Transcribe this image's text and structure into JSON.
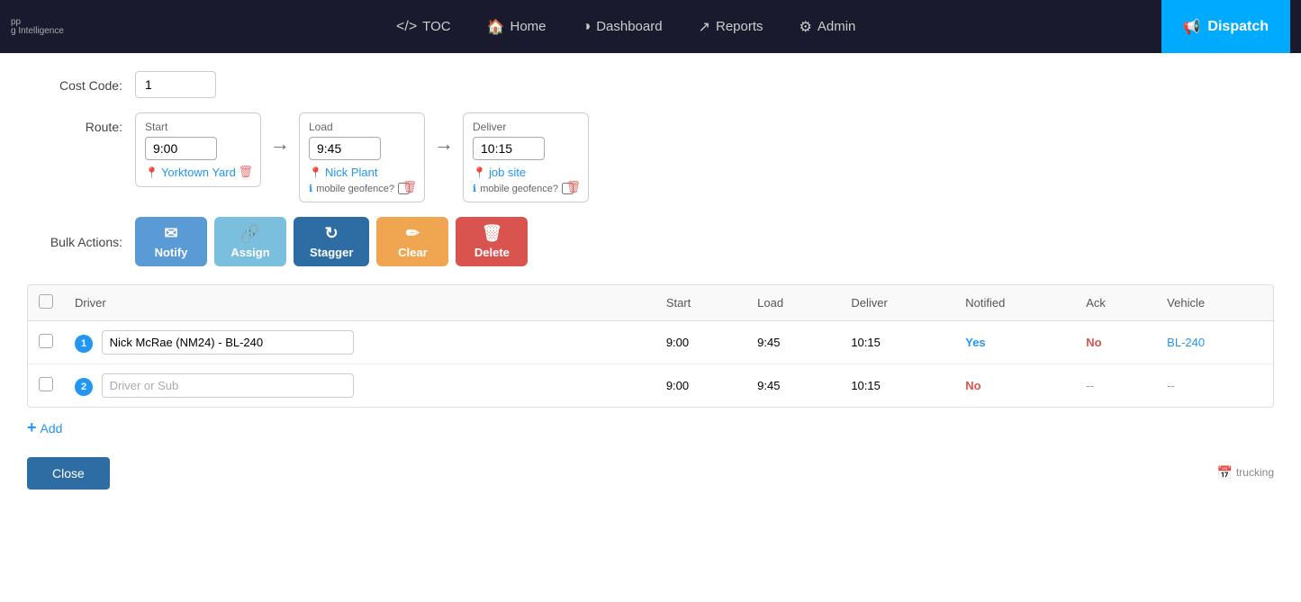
{
  "navbar": {
    "brand": "pp",
    "brand_sub": "g Intelligence",
    "links": [
      {
        "id": "toc",
        "icon": "</>",
        "label": "TOC"
      },
      {
        "id": "home",
        "icon": "🏠",
        "label": "Home"
      },
      {
        "id": "dashboard",
        "icon": "◑",
        "label": "Dashboard"
      },
      {
        "id": "reports",
        "icon": "↗",
        "label": "Reports"
      },
      {
        "id": "admin",
        "icon": "⚙",
        "label": "Admin"
      }
    ],
    "dispatch_label": "Dispatch"
  },
  "cost_code": {
    "label": "Cost Code:",
    "value": "1"
  },
  "route": {
    "label": "Route:",
    "start": {
      "section_label": "Start",
      "time": "9:00",
      "location": "Yorktown Yard"
    },
    "load": {
      "section_label": "Load",
      "time": "9:45",
      "location": "Nick Plant",
      "geofence": "mobile geofence?"
    },
    "deliver": {
      "section_label": "Deliver",
      "time": "10:15",
      "location": "job site",
      "geofence": "mobile geofence?"
    }
  },
  "bulk_actions": {
    "label": "Bulk Actions:",
    "buttons": [
      {
        "id": "notify",
        "icon": "✉",
        "label": "Notify",
        "cls": "btn-notify"
      },
      {
        "id": "assign",
        "icon": "🔗",
        "label": "Assign",
        "cls": "btn-assign"
      },
      {
        "id": "stagger",
        "icon": "↻",
        "label": "Stagger",
        "cls": "btn-stagger"
      },
      {
        "id": "clear",
        "icon": "✏",
        "label": "Clear",
        "cls": "btn-clear"
      },
      {
        "id": "delete",
        "icon": "🗑",
        "label": "Delete",
        "cls": "btn-delete"
      }
    ]
  },
  "table": {
    "headers": [
      "",
      "Driver",
      "Start",
      "Load",
      "Deliver",
      "Notified",
      "Ack",
      "Vehicle"
    ],
    "rows": [
      {
        "badge": "1",
        "driver_value": "Nick McRae (NM24) - BL-240",
        "start": "9:00",
        "load": "9:45",
        "deliver": "10:15",
        "notified": "Yes",
        "notified_cls": "status-yes",
        "ack": "No",
        "ack_cls": "status-no",
        "vehicle": "BL-240",
        "vehicle_cls": "status-vehicle"
      },
      {
        "badge": "2",
        "driver_placeholder": "Driver or Sub",
        "driver_value": "",
        "start": "9:00",
        "load": "9:45",
        "deliver": "10:15",
        "notified": "No",
        "notified_cls": "status-no",
        "ack": "--",
        "ack_cls": "status-dash",
        "vehicle": "--",
        "vehicle_cls": "status-dash"
      }
    ]
  },
  "add_label": "Add",
  "close_label": "Close",
  "trucking_label": "trucking"
}
